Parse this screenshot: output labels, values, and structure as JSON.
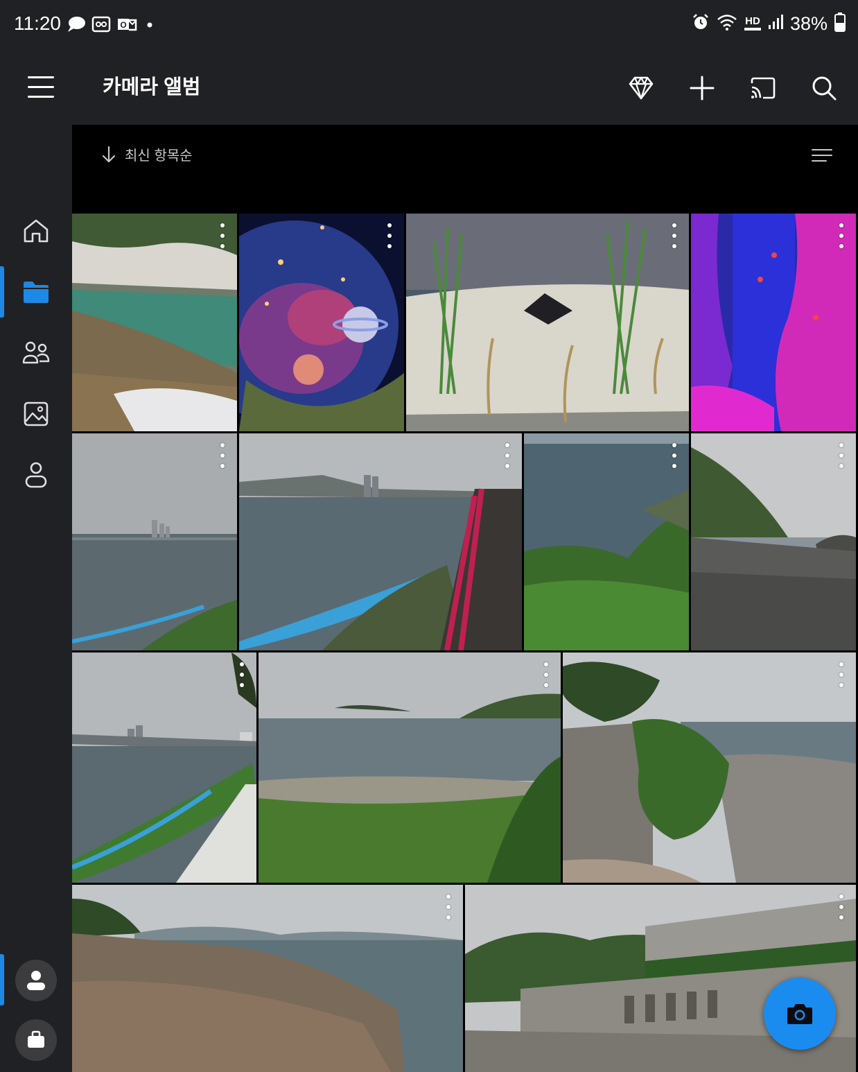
{
  "status_bar": {
    "time": "11:20",
    "left_icons": [
      "chat-bubble-icon",
      "cassette-icon",
      "outlook-icon",
      "dot-icon"
    ],
    "right_icons": [
      "alarm-icon",
      "wifi-icon",
      "hd-voice-icon",
      "signal-icon",
      "battery-icon"
    ],
    "hd_label": "HD",
    "battery": "38%"
  },
  "app_bar": {
    "title": "카메라 앨범",
    "actions": [
      "premium-diamond-icon",
      "add-icon",
      "cast-icon",
      "search-icon"
    ]
  },
  "rail": {
    "items": [
      "home-icon",
      "folder-icon",
      "people-icon",
      "photo-icon",
      "user-outline-icon"
    ],
    "active_index": 1,
    "bottom_items": [
      "personal-account-icon",
      "work-briefcase-icon"
    ],
    "active_bottom_index": 0
  },
  "sort": {
    "label": "최신 항목순"
  },
  "photos": [
    {
      "name": "photo-river-rocks",
      "desc": "rocky stream with clear green water"
    },
    {
      "name": "photo-space-sphere",
      "desc": "glowing glass sphere with planets and stars"
    },
    {
      "name": "photo-aquarium-sand",
      "desc": "aquarium sand with sea grass and garden eels"
    },
    {
      "name": "photo-aquarium-coral",
      "desc": "purple neon coral aquarium with fish"
    },
    {
      "name": "photo-foggy-sea-city",
      "desc": "foggy bay with city skyline"
    },
    {
      "name": "photo-bay-walkway",
      "desc": "bay view from red-railed walkway"
    },
    {
      "name": "photo-sea-cliff-plants",
      "desc": "sea below cliff with green plants"
    },
    {
      "name": "photo-pebble-beach",
      "desc": "pebble beach with forested headland"
    },
    {
      "name": "photo-coast-path",
      "desc": "coastal path with city towers"
    },
    {
      "name": "photo-beach-islands",
      "desc": "beach with small islands"
    },
    {
      "name": "photo-stone-wall-tree",
      "desc": "old stone wall with tree and sea"
    },
    {
      "name": "photo-rocky-shore",
      "desc": "rocky shore with distant islands"
    },
    {
      "name": "photo-fortress-wall",
      "desc": "stone fortress terraces with trees"
    }
  ],
  "fab": {
    "icon": "camera-icon"
  },
  "colors": {
    "accent": "#1e88e5",
    "fab": "#1a8cf0",
    "bar": "#202124",
    "rail_bottom": "#3c3c3e"
  }
}
